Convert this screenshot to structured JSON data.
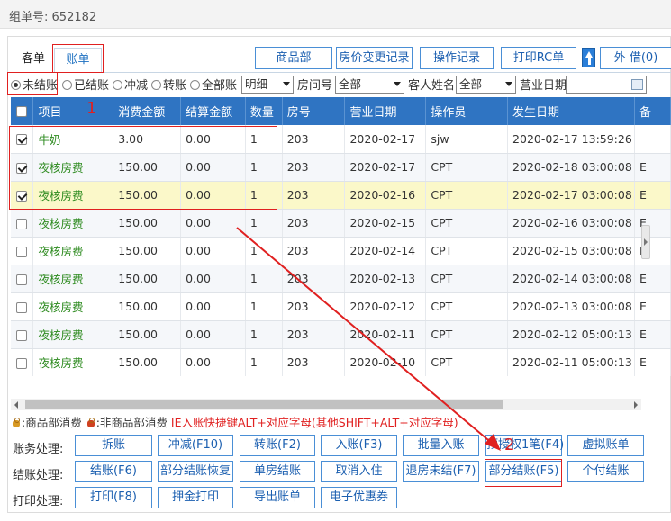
{
  "header": {
    "group_label": "组单号:",
    "group_no": "652182"
  },
  "tabs": [
    {
      "label": "客单"
    },
    {
      "label": "账单"
    }
  ],
  "top_buttons": {
    "goods": "商品部",
    "price_change": "房价变更记录",
    "op_log": "操作记录",
    "print_rc": "打印RC单",
    "external": "外 借(0)"
  },
  "filter": {
    "radios": [
      "未结账",
      "已结账",
      "冲减",
      "转账",
      "全部账"
    ],
    "selected_radio": 0,
    "detail_value": "明细",
    "room_label": "房间号",
    "room_value": "全部",
    "guest_label": "客人姓名",
    "guest_value": "全部",
    "bizdate_label": "营业日期"
  },
  "table": {
    "columns": [
      "项目",
      "消费金额",
      "结算金额",
      "数量",
      "房号",
      "营业日期",
      "操作员",
      "发生日期",
      "备"
    ],
    "rows": [
      {
        "checked": true,
        "item": "牛奶",
        "amount": "3.00",
        "settle": "0.00",
        "qty": "1",
        "room": "203",
        "bizdate": "2020-02-17",
        "operator": "sjw",
        "occurred": "2020-02-17 13:59:26",
        "extra": ""
      },
      {
        "checked": true,
        "item": "夜核房费",
        "amount": "150.00",
        "settle": "0.00",
        "qty": "1",
        "room": "203",
        "bizdate": "2020-02-17",
        "operator": "CPT",
        "occurred": "2020-02-18 03:00:08",
        "extra": "E"
      },
      {
        "checked": true,
        "item": "夜核房费",
        "amount": "150.00",
        "settle": "0.00",
        "qty": "1",
        "room": "203",
        "bizdate": "2020-02-16",
        "operator": "CPT",
        "occurred": "2020-02-17 03:00:08",
        "extra": "E"
      },
      {
        "checked": false,
        "item": "夜核房费",
        "amount": "150.00",
        "settle": "0.00",
        "qty": "1",
        "room": "203",
        "bizdate": "2020-02-15",
        "operator": "CPT",
        "occurred": "2020-02-16 03:00:08",
        "extra": "E"
      },
      {
        "checked": false,
        "item": "夜核房费",
        "amount": "150.00",
        "settle": "0.00",
        "qty": "1",
        "room": "203",
        "bizdate": "2020-02-14",
        "operator": "CPT",
        "occurred": "2020-02-15 03:00:08",
        "extra": "E"
      },
      {
        "checked": false,
        "item": "夜核房费",
        "amount": "150.00",
        "settle": "0.00",
        "qty": "1",
        "room": "203",
        "bizdate": "2020-02-13",
        "operator": "CPT",
        "occurred": "2020-02-14 03:00:08",
        "extra": "E"
      },
      {
        "checked": false,
        "item": "夜核房费",
        "amount": "150.00",
        "settle": "0.00",
        "qty": "1",
        "room": "203",
        "bizdate": "2020-02-12",
        "operator": "CPT",
        "occurred": "2020-02-13 03:00:08",
        "extra": "E"
      },
      {
        "checked": false,
        "item": "夜核房费",
        "amount": "150.00",
        "settle": "0.00",
        "qty": "1",
        "room": "203",
        "bizdate": "2020-02-11",
        "operator": "CPT",
        "occurred": "2020-02-12 05:00:13",
        "extra": "E"
      },
      {
        "checked": false,
        "item": "夜核房费",
        "amount": "150.00",
        "settle": "0.00",
        "qty": "1",
        "room": "203",
        "bizdate": "2020-02-10",
        "operator": "CPT",
        "occurred": "2020-02-11 05:00:13",
        "extra": "E"
      }
    ],
    "highlight_row": 2
  },
  "legend": {
    "goods_text": ":商品部消费",
    "non_goods_text": ":非商品部消费",
    "hint": "IE入账快捷键ALT+对应字母(其他SHIFT+ALT+对应字母)"
  },
  "actions": {
    "account_label": "账务处理:",
    "account": [
      "拆账",
      "冲减(F10)",
      "转账(F2)",
      "入账(F3)",
      "批量入账",
      "预授权1笔(F4)",
      "虚拟账单"
    ],
    "checkout_label": "结账处理:",
    "checkout": [
      "结账(F6)",
      "部分结账恢复",
      "单房结账",
      "取消入住",
      "退房未结(F7)",
      "部分结账(F5)",
      "个付结账"
    ],
    "print_label": "打印处理:",
    "print": [
      "打印(F8)",
      "押金打印",
      "导出账单",
      "电子优惠券"
    ]
  },
  "annotations": {
    "step1": "1",
    "step2": "2",
    "color": "#e02020"
  }
}
